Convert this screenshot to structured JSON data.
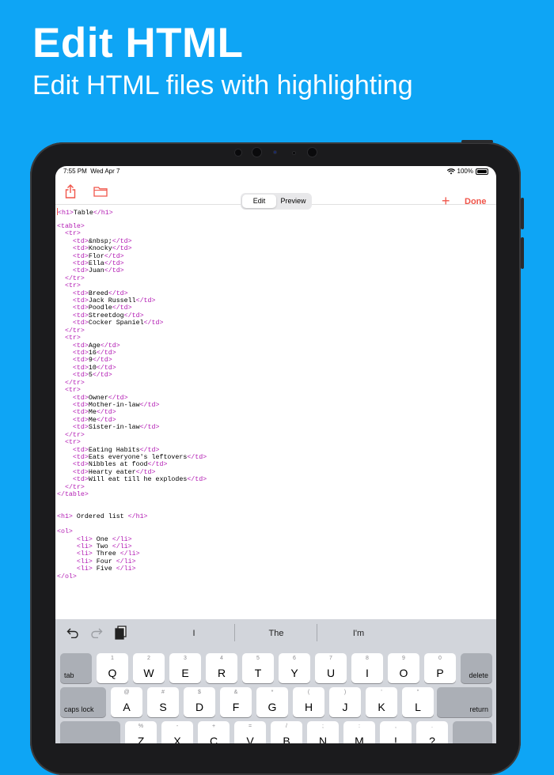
{
  "promo": {
    "title": "Edit HTML",
    "subtitle": "Edit HTML files with highlighting"
  },
  "status_bar": {
    "time": "7:55 PM",
    "date": "Wed Apr 7",
    "battery": "100%",
    "wifi_icon": "wifi-icon",
    "battery_icon": "battery-icon"
  },
  "toolbar": {
    "share_icon": "share-icon",
    "folder_icon": "folder-icon",
    "tabs": [
      "Edit",
      "Preview"
    ],
    "active_tab": "Edit",
    "add_icon": "plus-icon",
    "done_label": "Done",
    "accent_color": "#f0554a"
  },
  "editor": {
    "tag_color": "#b21ab3",
    "lines": [
      {
        "indent": "",
        "open": "<h1>",
        "text": "Table",
        "close": "</h1>"
      },
      {
        "indent": "",
        "open": "",
        "text": "",
        "close": ""
      },
      {
        "indent": "",
        "open": "<table>",
        "text": "",
        "close": ""
      },
      {
        "indent": "  ",
        "open": "<tr>",
        "text": "",
        "close": ""
      },
      {
        "indent": "    ",
        "open": "<td>",
        "text": "&nbsp;",
        "close": "</td>"
      },
      {
        "indent": "    ",
        "open": "<td>",
        "text": "Knocky",
        "close": "</td>"
      },
      {
        "indent": "    ",
        "open": "<td>",
        "text": "Flor",
        "close": "</td>"
      },
      {
        "indent": "    ",
        "open": "<td>",
        "text": "Ella",
        "close": "</td>"
      },
      {
        "indent": "    ",
        "open": "<td>",
        "text": "Juan",
        "close": "</td>"
      },
      {
        "indent": "  ",
        "open": "</tr>",
        "text": "",
        "close": ""
      },
      {
        "indent": "  ",
        "open": "<tr>",
        "text": "",
        "close": ""
      },
      {
        "indent": "    ",
        "open": "<td>",
        "text": "Breed",
        "close": "</td>"
      },
      {
        "indent": "    ",
        "open": "<td>",
        "text": "Jack Russell",
        "close": "</td>"
      },
      {
        "indent": "    ",
        "open": "<td>",
        "text": "Poodle",
        "close": "</td>"
      },
      {
        "indent": "    ",
        "open": "<td>",
        "text": "Streetdog",
        "close": "</td>"
      },
      {
        "indent": "    ",
        "open": "<td>",
        "text": "Cocker Spaniel",
        "close": "</td>"
      },
      {
        "indent": "  ",
        "open": "</tr>",
        "text": "",
        "close": ""
      },
      {
        "indent": "  ",
        "open": "<tr>",
        "text": "",
        "close": ""
      },
      {
        "indent": "    ",
        "open": "<td>",
        "text": "Age",
        "close": "</td>"
      },
      {
        "indent": "    ",
        "open": "<td>",
        "text": "16",
        "close": "</td>"
      },
      {
        "indent": "    ",
        "open": "<td>",
        "text": "9",
        "close": "</td>"
      },
      {
        "indent": "    ",
        "open": "<td>",
        "text": "10",
        "close": "</td>"
      },
      {
        "indent": "    ",
        "open": "<td>",
        "text": "5",
        "close": "</td>"
      },
      {
        "indent": "  ",
        "open": "</tr>",
        "text": "",
        "close": ""
      },
      {
        "indent": "  ",
        "open": "<tr>",
        "text": "",
        "close": ""
      },
      {
        "indent": "    ",
        "open": "<td>",
        "text": "Owner",
        "close": "</td>"
      },
      {
        "indent": "    ",
        "open": "<td>",
        "text": "Mother-in-law",
        "close": "</td>"
      },
      {
        "indent": "    ",
        "open": "<td>",
        "text": "Me",
        "close": "</td>"
      },
      {
        "indent": "    ",
        "open": "<td>",
        "text": "Me",
        "close": "</td>"
      },
      {
        "indent": "    ",
        "open": "<td>",
        "text": "Sister-in-law",
        "close": "</td>"
      },
      {
        "indent": "  ",
        "open": "</tr>",
        "text": "",
        "close": ""
      },
      {
        "indent": "  ",
        "open": "<tr>",
        "text": "",
        "close": ""
      },
      {
        "indent": "    ",
        "open": "<td>",
        "text": "Eating Habits",
        "close": "</td>"
      },
      {
        "indent": "    ",
        "open": "<td>",
        "text": "Eats everyone's leftovers",
        "close": "</td>"
      },
      {
        "indent": "    ",
        "open": "<td>",
        "text": "Nibbles at food",
        "close": "</td>"
      },
      {
        "indent": "    ",
        "open": "<td>",
        "text": "Hearty eater",
        "close": "</td>"
      },
      {
        "indent": "    ",
        "open": "<td>",
        "text": "Will eat till he explodes",
        "close": "</td>"
      },
      {
        "indent": "  ",
        "open": "</tr>",
        "text": "",
        "close": ""
      },
      {
        "indent": "",
        "open": "</table>",
        "text": "",
        "close": ""
      },
      {
        "indent": "",
        "open": "",
        "text": "",
        "close": ""
      },
      {
        "indent": "",
        "open": "",
        "text": "",
        "close": ""
      },
      {
        "indent": "",
        "open": "<h1>",
        "text": " Ordered list ",
        "close": "</h1>"
      },
      {
        "indent": "",
        "open": "",
        "text": "",
        "close": ""
      },
      {
        "indent": "",
        "open": "<ol>",
        "text": "",
        "close": ""
      },
      {
        "indent": "     ",
        "open": "<li>",
        "text": " One ",
        "close": "</li>"
      },
      {
        "indent": "     ",
        "open": "<li>",
        "text": " Two ",
        "close": "</li>"
      },
      {
        "indent": "     ",
        "open": "<li>",
        "text": " Three ",
        "close": "</li>"
      },
      {
        "indent": "     ",
        "open": "<li>",
        "text": " Four ",
        "close": "</li>"
      },
      {
        "indent": "     ",
        "open": "<li>",
        "text": " Five ",
        "close": "</li>"
      },
      {
        "indent": "",
        "open": "</ol>",
        "text": "",
        "close": ""
      }
    ]
  },
  "keyboard": {
    "toolbar": {
      "undo_icon": "undo-icon",
      "redo_icon": "redo-icon",
      "paste_icon": "clipboard-icon",
      "suggestions": [
        "I",
        "The",
        "I'm"
      ]
    },
    "row1": {
      "left_key": "tab",
      "keys": [
        {
          "ch": "Q",
          "alt": "1"
        },
        {
          "ch": "W",
          "alt": "2"
        },
        {
          "ch": "E",
          "alt": "3"
        },
        {
          "ch": "R",
          "alt": "4"
        },
        {
          "ch": "T",
          "alt": "5"
        },
        {
          "ch": "Y",
          "alt": "6"
        },
        {
          "ch": "U",
          "alt": "7"
        },
        {
          "ch": "I",
          "alt": "8"
        },
        {
          "ch": "O",
          "alt": "9"
        },
        {
          "ch": "P",
          "alt": "0"
        }
      ],
      "right_key": "delete"
    },
    "row2": {
      "left_key": "caps lock",
      "keys": [
        {
          "ch": "A",
          "alt": "@"
        },
        {
          "ch": "S",
          "alt": "#"
        },
        {
          "ch": "D",
          "alt": "$"
        },
        {
          "ch": "F",
          "alt": "&"
        },
        {
          "ch": "G",
          "alt": "*"
        },
        {
          "ch": "H",
          "alt": "("
        },
        {
          "ch": "J",
          "alt": ")"
        },
        {
          "ch": "K",
          "alt": "'"
        },
        {
          "ch": "L",
          "alt": "\""
        }
      ],
      "right_key": "return"
    },
    "row3": {
      "keys": [
        {
          "ch": "Z",
          "alt": "%"
        },
        {
          "ch": "X",
          "alt": "-"
        },
        {
          "ch": "C",
          "alt": "+"
        },
        {
          "ch": "V",
          "alt": "="
        },
        {
          "ch": "B",
          "alt": "/"
        },
        {
          "ch": "N",
          "alt": ";"
        },
        {
          "ch": "M",
          "alt": ":"
        },
        {
          "ch": "!",
          "alt": ","
        },
        {
          "ch": "?",
          "alt": "."
        }
      ]
    }
  }
}
